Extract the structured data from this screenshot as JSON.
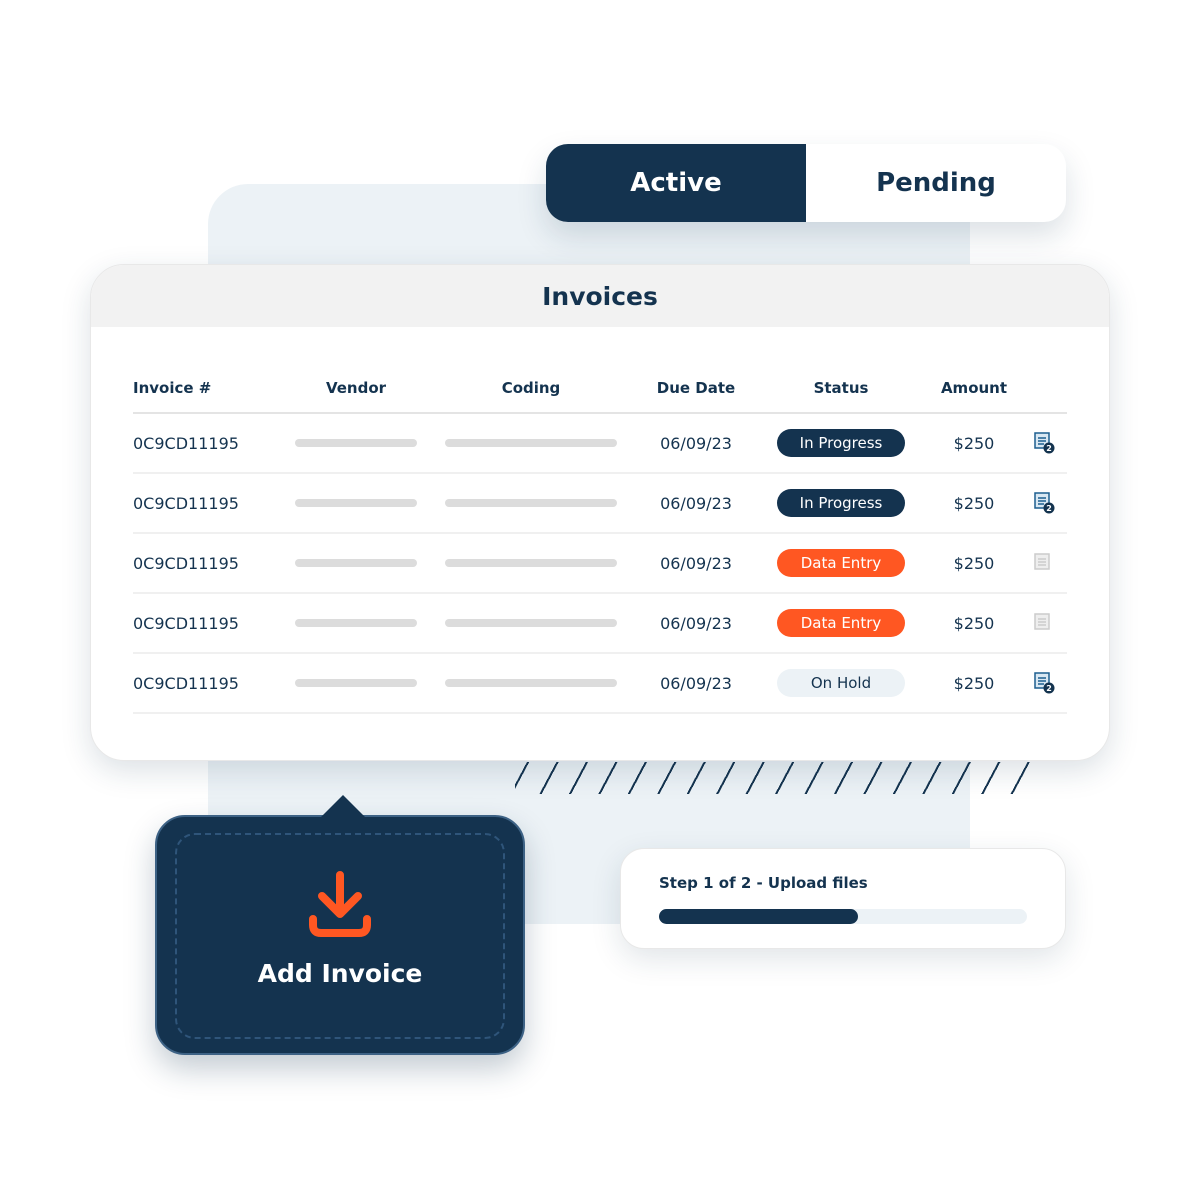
{
  "tabs": [
    {
      "label": "Active",
      "active": true
    },
    {
      "label": "Pending",
      "active": false
    }
  ],
  "invoices": {
    "title": "Invoices",
    "columns": [
      "Invoice #",
      "Vendor",
      "Coding",
      "Due Date",
      "Status",
      "Amount"
    ],
    "rows": [
      {
        "id": "0C9CD11195",
        "due": "06/09/23",
        "status": "In Progress",
        "amount": "$250",
        "doc_icon": "document-badge-2-icon",
        "attachments": "2"
      },
      {
        "id": "0C9CD11195",
        "due": "06/09/23",
        "status": "In Progress",
        "amount": "$250",
        "doc_icon": "document-badge-2-icon",
        "attachments": "2"
      },
      {
        "id": "0C9CD11195",
        "due": "06/09/23",
        "status": "Data Entry",
        "amount": "$250",
        "doc_icon": "document-gray-icon",
        "attachments": ""
      },
      {
        "id": "0C9CD11195",
        "due": "06/09/23",
        "status": "Data Entry",
        "amount": "$250",
        "doc_icon": "document-gray-icon",
        "attachments": ""
      },
      {
        "id": "0C9CD11195",
        "due": "06/09/23",
        "status": "On Hold",
        "amount": "$250",
        "doc_icon": "document-badge-2-icon",
        "attachments": "2"
      }
    ]
  },
  "add_invoice": {
    "label": "Add Invoice",
    "icon": "download-tray-icon"
  },
  "upload": {
    "label": "Step 1 of 2 - Upload files",
    "progress_percent": 54
  },
  "colors": {
    "navy": "#14334f",
    "orange": "#ff5722",
    "light": "#ecf2f6"
  }
}
